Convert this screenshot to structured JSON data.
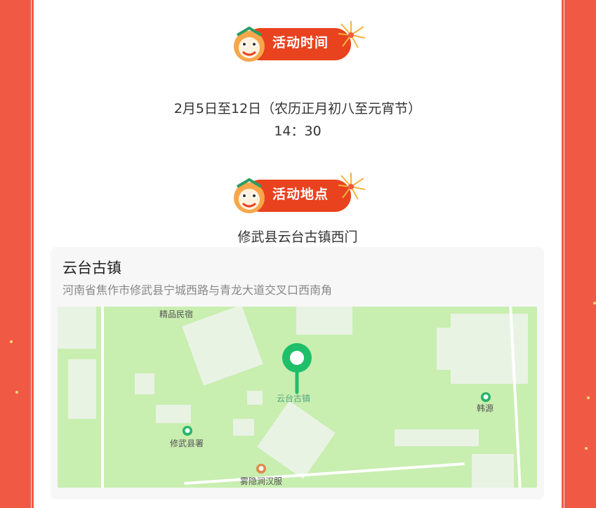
{
  "time_section": {
    "title": "活动时间",
    "date_line": "2月5日至12日（农历正月初八至元宵节）",
    "time_line": "14：30"
  },
  "location_section": {
    "title": "活动地点",
    "place": "修武县云台古镇西门"
  },
  "location_card": {
    "name": "云台古镇",
    "address": "河南省焦作市修武县宁城西路与青龙大道交叉口西南角",
    "map": {
      "pin_label": "云台古镇",
      "poi_labels": [
        "精品民宿",
        "韩源",
        "修武县署",
        "雾隐涧汉服体验馆"
      ],
      "marker_color": "#1fbf6a"
    }
  },
  "colors": {
    "background": "#f05a45",
    "badge": "#e9421e",
    "content": "#ffffff"
  }
}
